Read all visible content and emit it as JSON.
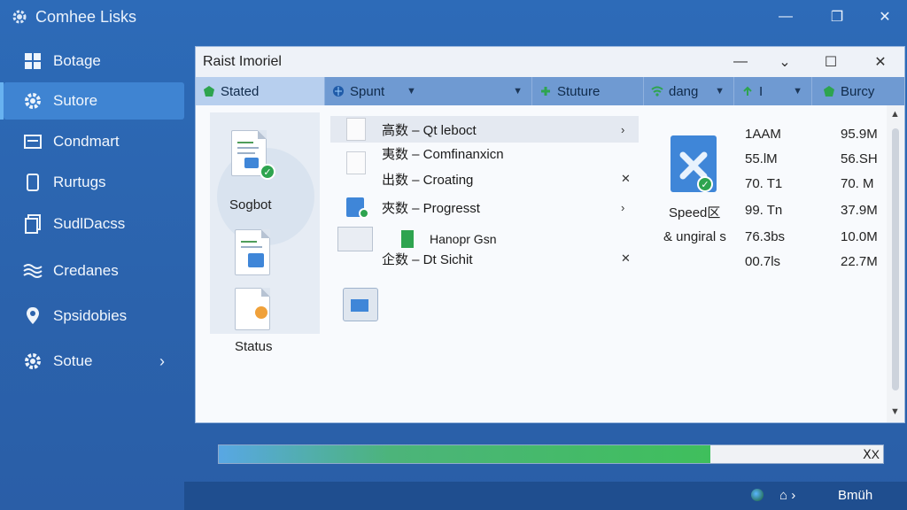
{
  "window": {
    "title": "Comhee Lisks",
    "minimize_glyph": "—",
    "restore_glyph": "❐",
    "close_glyph": "✕"
  },
  "sidebar": {
    "items": [
      {
        "label": "Botage",
        "icon": "grid-icon"
      },
      {
        "label": "Sutore",
        "icon": "gear-icon",
        "active": true
      },
      {
        "label": "Condmart",
        "icon": "card-icon"
      },
      {
        "label": "Rurtugs",
        "icon": "tablet-icon"
      },
      {
        "label": "SudlDacss",
        "icon": "documents-icon"
      },
      {
        "label": "Credanes",
        "icon": "waves-icon"
      },
      {
        "label": "Spsidobies",
        "icon": "location-pin-icon"
      },
      {
        "label": "Sotue",
        "icon": "gear-icon",
        "has_chevron": true
      }
    ],
    "chevron_glyph": "›"
  },
  "dialog": {
    "title": "Raist Imoriel",
    "tabs": [
      {
        "label": "Stated",
        "icon": "green-gem-icon",
        "active": true
      },
      {
        "label": "Spunt",
        "icon": "globe-icon",
        "dropdown": true
      },
      {
        "label": "Stuture",
        "icon": "green-plus-icon"
      },
      {
        "label": "dang",
        "icon": "wifi-icon",
        "dropdown": true
      },
      {
        "label": "I",
        "icon": "green-arrow-icon",
        "dropdown": true
      },
      {
        "label": "Burcy",
        "icon": "green-gem-icon"
      }
    ],
    "left_panel": {
      "label_top": "Sogbot",
      "label_bottom": "Status"
    },
    "rows": [
      {
        "text": "高数 – Qt leboct",
        "action": "›"
      },
      {
        "text": "夷数 – Comfinanxicn",
        "action": ""
      },
      {
        "text": "出数 – Croating",
        "action": "✕"
      },
      {
        "text": "夾数 – Progresst",
        "action": "›"
      },
      {
        "text": "Hanopr Gsn",
        "action": ""
      },
      {
        "text": "企数 – Dt Sichit",
        "action": "✕"
      }
    ],
    "speed": {
      "label": "Speed区",
      "sublabel": "& ungiral s"
    },
    "col1": [
      "1AAM",
      "55.lM",
      "70. T1",
      "99. Tn",
      "76.3bs",
      "00.7ls"
    ],
    "col2": [
      "95.9M",
      "56.SH",
      "70. M",
      "37.9M",
      "10.0M",
      "22.7M"
    ]
  },
  "progress": {
    "percent": 74,
    "end_label": "ⅩX"
  },
  "statusbar": {
    "right_label": "Bmüh",
    "mid_glyph": "⌂ ›"
  },
  "colors": {
    "accent": "#3f84d2",
    "green": "#2ea44f",
    "tabbar": "#6f9ad2"
  }
}
